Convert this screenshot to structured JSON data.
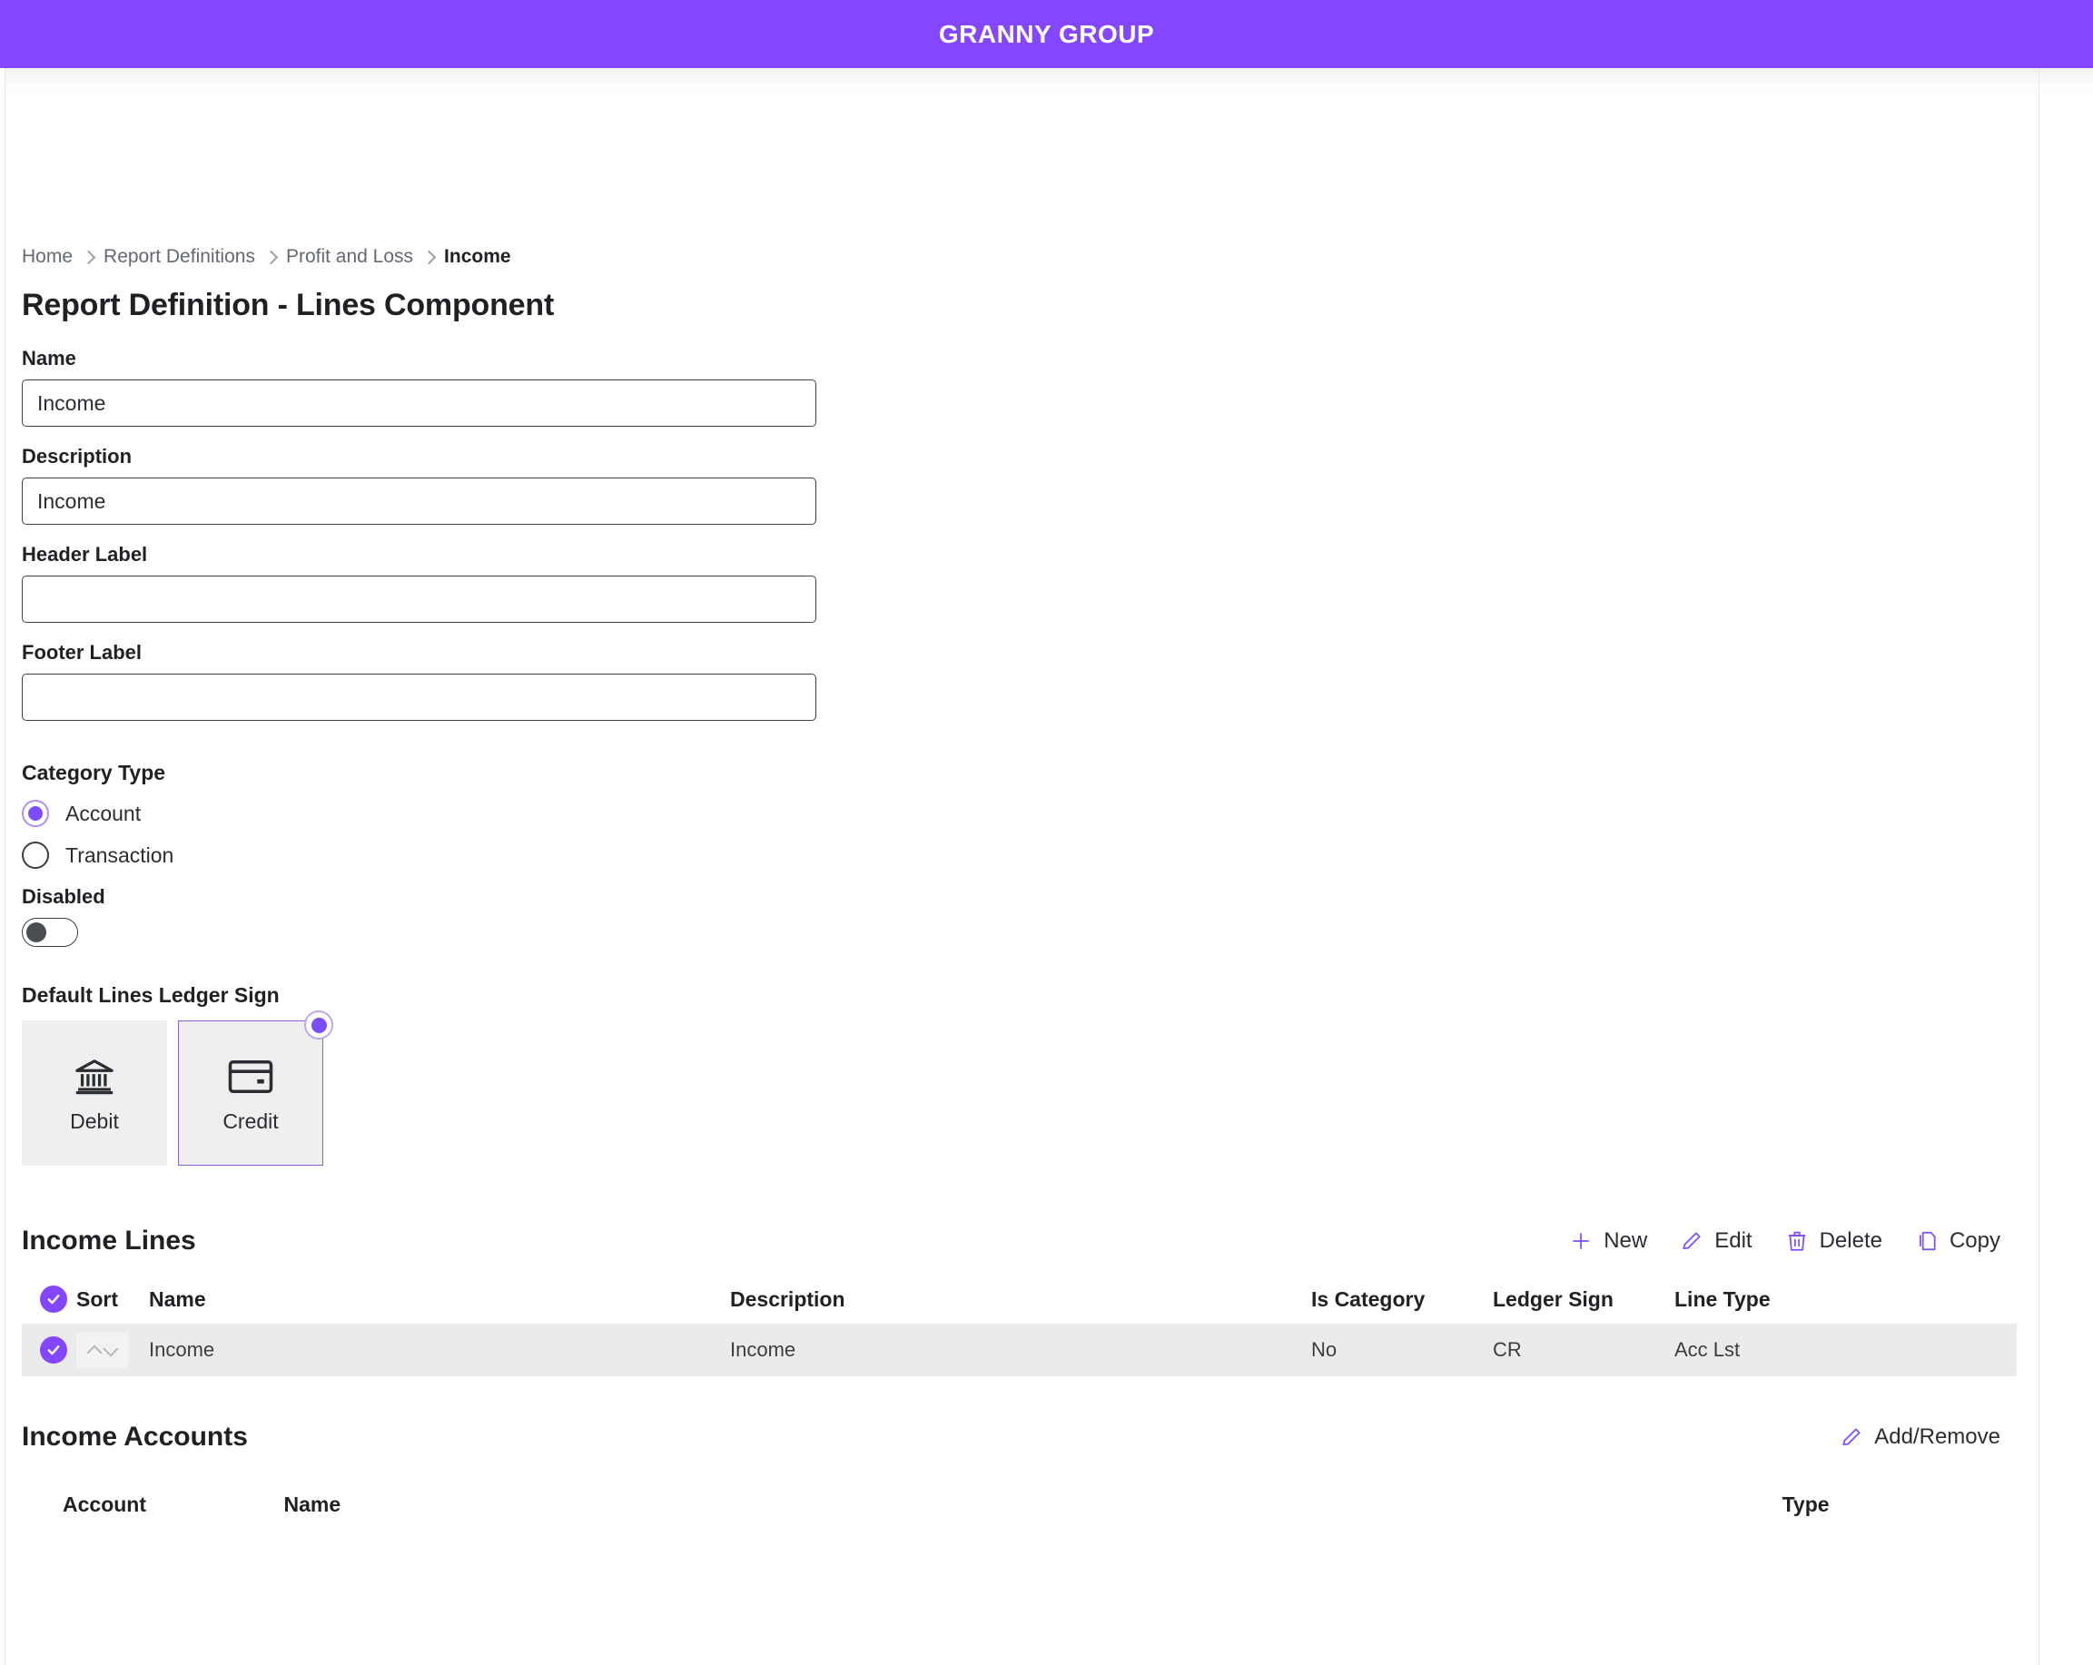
{
  "brand": {
    "title": "GRANNY GROUP",
    "bar_color": "#8447ff"
  },
  "breadcrumb": [
    {
      "label": "Home"
    },
    {
      "label": "Report Definitions"
    },
    {
      "label": "Profit and Loss"
    },
    {
      "label": "Income"
    }
  ],
  "page": {
    "title": "Report Definition - Lines Component"
  },
  "form": {
    "name": {
      "label": "Name",
      "value": "Income",
      "placeholder": ""
    },
    "description": {
      "label": "Description",
      "value": "Income",
      "placeholder": ""
    },
    "header_label": {
      "label": "Header Label",
      "value": "",
      "placeholder": ""
    },
    "footer_label": {
      "label": "Footer Label",
      "value": "",
      "placeholder": ""
    }
  },
  "category_type": {
    "label": "Category Type",
    "options": [
      {
        "label": "Account",
        "selected": true
      },
      {
        "label": "Transaction",
        "selected": false
      }
    ]
  },
  "disabled": {
    "label": "Disabled",
    "value": "off"
  },
  "ledger_sign": {
    "label": "Default Lines Ledger Sign",
    "options": [
      {
        "label": "Debit",
        "icon": "bank-icon",
        "selected": false
      },
      {
        "label": "Credit",
        "icon": "credit-card-icon",
        "selected": true
      }
    ]
  },
  "lines_section": {
    "title": "Income Lines",
    "toolbar": [
      {
        "label": "New",
        "icon": "plus-icon"
      },
      {
        "label": "Edit",
        "icon": "pencil-icon"
      },
      {
        "label": "Delete",
        "icon": "trash-icon"
      },
      {
        "label": "Copy",
        "icon": "copy-icon"
      }
    ],
    "columns": [
      "Sort",
      "Name",
      "Description",
      "Is Category",
      "Ledger Sign",
      "Line Type"
    ],
    "rows": [
      {
        "selected": true,
        "name": "Income",
        "description": "Income",
        "is_category": "No",
        "ledger_sign": "CR",
        "line_type": "Acc Lst"
      }
    ]
  },
  "accounts_section": {
    "title": "Income Accounts",
    "action": {
      "label": "Add/Remove",
      "icon": "pencil-icon"
    },
    "columns": [
      "Account",
      "Name",
      "Type"
    ],
    "rows": []
  },
  "colors": {
    "accent": "#8447ff",
    "radio_dot": "#7c4dff",
    "row_bg": "#ebebeb",
    "card_bg": "#f0efef"
  }
}
